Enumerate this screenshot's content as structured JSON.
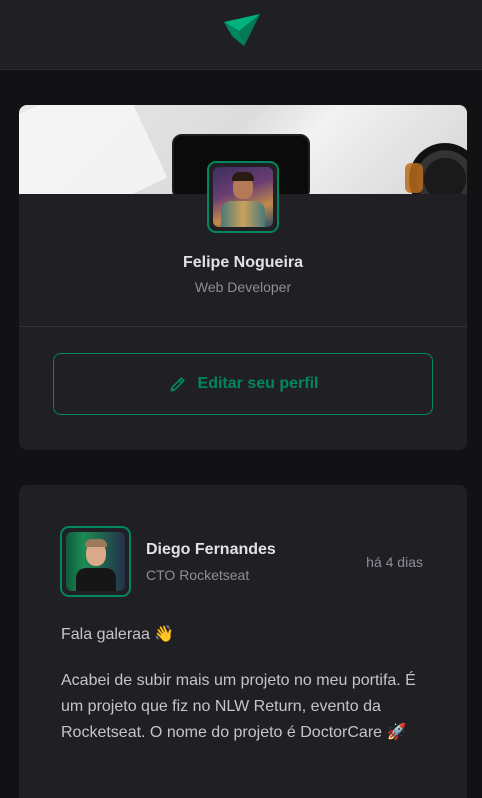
{
  "header": {
    "logo_icon": "ignite-logo-icon",
    "brand_colors": {
      "primary": "#00B37E",
      "dark": "#00875F"
    }
  },
  "profile": {
    "name": "Felipe Nogueira",
    "role": "Web Developer",
    "edit_label": "Editar seu perfil",
    "edit_icon": "pencil-line-icon"
  },
  "post": {
    "author_name": "Diego Fernandes",
    "author_role": "CTO Rocketseat",
    "time": "há 4 dias",
    "paragraphs": [
      "Fala galeraa 👋",
      "Acabei de subir mais um projeto no meu portifa. É um projeto que fiz no NLW Return, evento da Rocketseat. O nome do projeto é DoctorCare 🚀"
    ]
  },
  "colors": {
    "background": "#121214",
    "surface": "#202024",
    "accent": "#00875F",
    "text_primary": "#E1E1E6",
    "text_secondary": "#8D8D99"
  }
}
